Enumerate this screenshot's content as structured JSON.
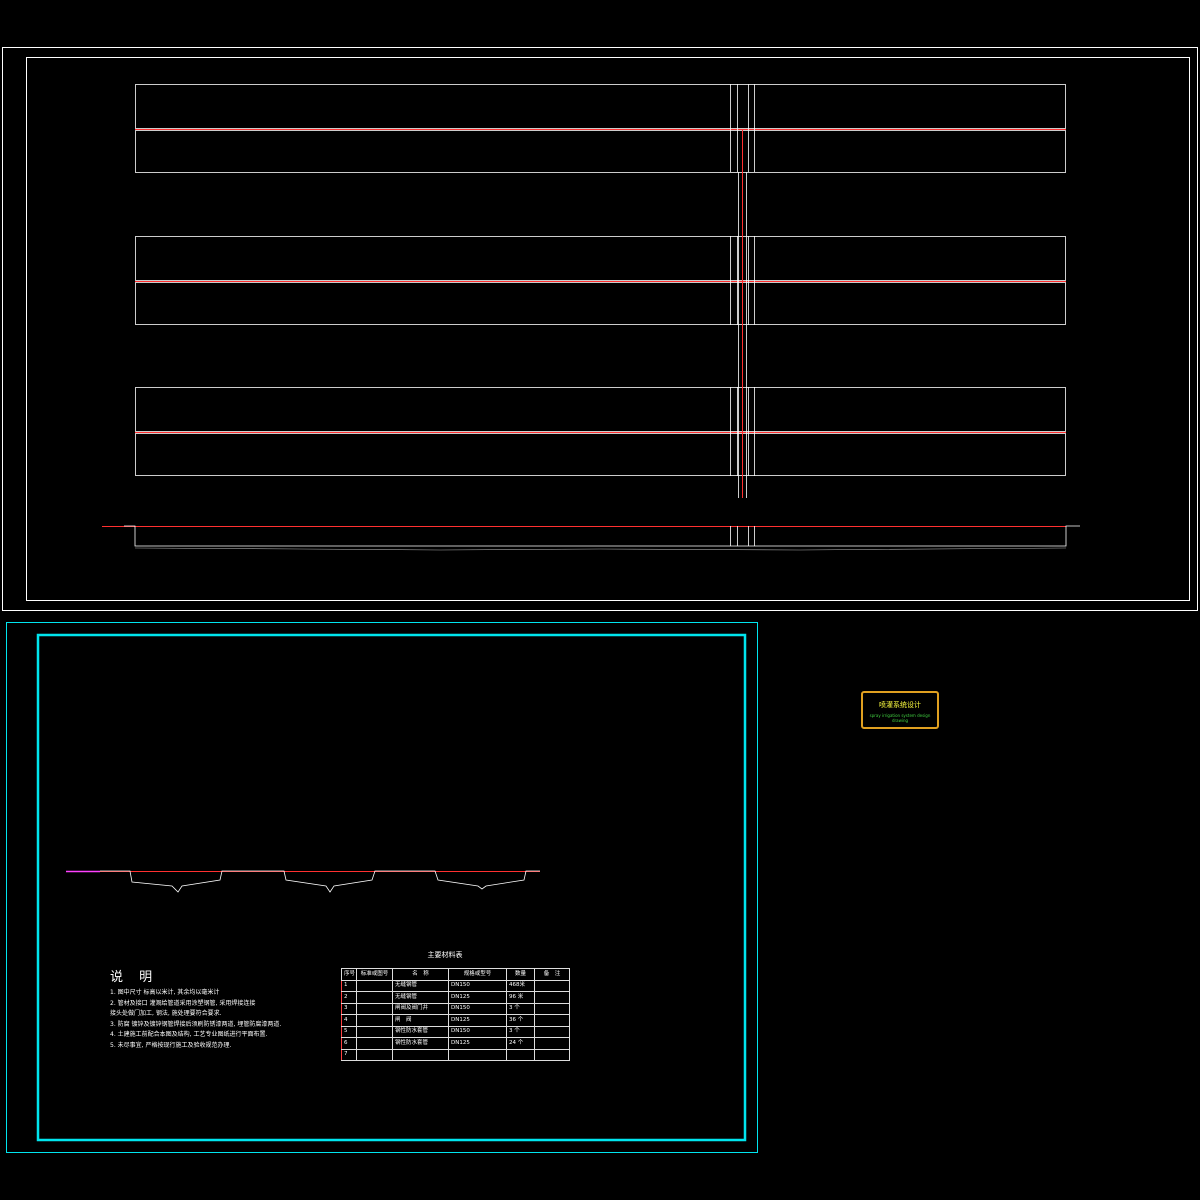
{
  "notes": {
    "title": "说 明",
    "items": [
      "1. 图中尺寸  标高以米计, 其余均以毫米计",
      "2. 管材及接口   灌溉给管道采用涂塑钢管, 采用焊接连接",
      "    接头处做门加工, 钢法, 施处理要符合要求.",
      "3. 防腐  镀锌及镀锌钢管焊接后须刷防锈漆两道, 埋管防腐漆两道.",
      "4. 土建施工前配合本图及结构, 工艺专业图纸进行平面布置.",
      "5. 未尽事宜, 严格按现行施工及验收规范办理."
    ]
  },
  "materials": {
    "title": "主要材料表",
    "headers": [
      "序号",
      "标准或图号",
      "名　称",
      "规格或型号",
      "数量",
      "备　注"
    ],
    "rows": [
      [
        "1",
        "",
        "无缝钢管",
        "DN150",
        "468米",
        ""
      ],
      [
        "2",
        "",
        "无缝钢管",
        "DN125",
        "96 米",
        ""
      ],
      [
        "3",
        "",
        "闸阀及阀门井",
        "DN150",
        "3 个",
        ""
      ],
      [
        "4",
        "",
        "闸　阀",
        "DN125",
        "36 个",
        ""
      ],
      [
        "5",
        "",
        "钢性防水套管",
        "DN150",
        "3 个",
        ""
      ],
      [
        "6",
        "",
        "钢性防水套管",
        "DN125",
        "24 个",
        ""
      ],
      [
        "7",
        "",
        "",
        "",
        "",
        ""
      ]
    ]
  },
  "stamp": {
    "main": "喷灌系统设计",
    "sub": "spray irrigation system design drawing"
  },
  "colors": {
    "frame": "#ffffff",
    "cyan_frame": "#00e5ee",
    "pipe_red": "#ff3030",
    "stamp_border": "#e0a020",
    "stamp_text": "#ffff40"
  }
}
